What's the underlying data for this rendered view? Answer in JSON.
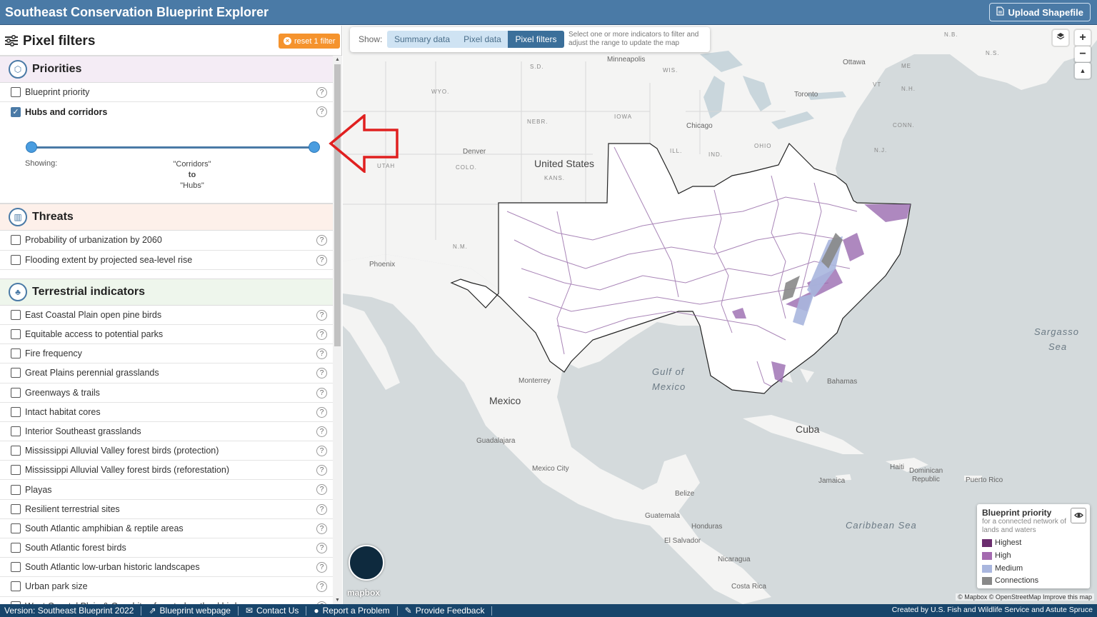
{
  "header": {
    "title": "Southeast  Conservation Blueprint Explorer",
    "upload_label": "Upload Shapefile"
  },
  "sidebar": {
    "title": "Pixel filters",
    "reset_label": "reset 1 filter",
    "priorities": {
      "title": "Priorities",
      "items": [
        {
          "label": "Blueprint priority",
          "checked": false
        },
        {
          "label": "Hubs and corridors",
          "checked": true
        }
      ],
      "slider": {
        "showing_label": "Showing:",
        "range_from": "\"Corridors\"",
        "range_to_word": "to",
        "range_to": "\"Hubs\""
      }
    },
    "threats": {
      "title": "Threats",
      "items": [
        {
          "label": "Probability of urbanization by 2060"
        },
        {
          "label": "Flooding extent by projected sea-level rise"
        }
      ]
    },
    "terrestrial": {
      "title": "Terrestrial indicators",
      "items": [
        {
          "label": "East Coastal Plain open pine birds"
        },
        {
          "label": "Equitable access to potential parks"
        },
        {
          "label": "Fire frequency"
        },
        {
          "label": "Great Plains perennial grasslands"
        },
        {
          "label": "Greenways & trails"
        },
        {
          "label": "Intact habitat cores"
        },
        {
          "label": "Interior Southeast grasslands"
        },
        {
          "label": "Mississippi Alluvial Valley forest birds (protection)"
        },
        {
          "label": "Mississippi Alluvial Valley forest birds (reforestation)"
        },
        {
          "label": "Playas"
        },
        {
          "label": "Resilient terrestrial sites"
        },
        {
          "label": "South Atlantic amphibian & reptile areas"
        },
        {
          "label": "South Atlantic forest birds"
        },
        {
          "label": "South Atlantic low-urban historic landscapes"
        },
        {
          "label": "Urban park size"
        },
        {
          "label": "West Coastal Plain & Ouachitas forested wetland birds"
        }
      ]
    },
    "help_glyph": "?"
  },
  "show_bar": {
    "label": "Show:",
    "options": [
      "Summary data",
      "Pixel data",
      "Pixel filters"
    ],
    "selected": "Pixel filters",
    "hint": "Select one or more indicators to filter and adjust the range to update the map"
  },
  "map_labels": {
    "us": "United States",
    "mexico": "Mexico",
    "cuba": "Cuba",
    "gulf": "Gulf of",
    "gulf2": "Mexico",
    "sargasso": "Sargasso",
    "sargasso2": "Sea",
    "caribbean": "Caribbean Sea",
    "minneapolis": "Minneapolis",
    "ottawa": "Ottawa",
    "toronto": "Toronto",
    "chicago": "Chicago",
    "denver": "Denver",
    "phoenix": "Phoenix",
    "monterrey": "Monterrey",
    "guadalajara": "Guadalajara",
    "mexico_city": "Mexico City",
    "bahamas": "Bahamas",
    "havana": "Haiti",
    "dominican": "Dominican",
    "dominican2": "Republic",
    "puerto_rico": "Puerto Rico",
    "jamaica": "Jamaica",
    "belize": "Belize",
    "guatemala": "Guatemala",
    "honduras": "Honduras",
    "el_salvador": "El Salvador",
    "nicaragua": "Nicaragua",
    "costa_rica": "Costa Rica",
    "sd": "S.D.",
    "wis": "WIS.",
    "nebr": "NEBR.",
    "iowa": "IOWA",
    "wyo": "WYO.",
    "utah": "UTAH",
    "colo": "COLO.",
    "kans": "KANS.",
    "nm": "N.M.",
    "ill": "ILL.",
    "ind": "IND.",
    "ohio": "OHIO",
    "nb": "N.B.",
    "me": "ME",
    "vt": "VT",
    "nh": "N.H.",
    "conn": "CONN.",
    "nj": "N.J.",
    "ns": "N.S."
  },
  "legend": {
    "title": "Blueprint priority",
    "subtitle": "for a connected network of lands and waters",
    "eye_icon": "eye-icon",
    "items": [
      {
        "label": "Highest",
        "color": "#6b2d6e"
      },
      {
        "label": "High",
        "color": "#a46ab0"
      },
      {
        "label": "Medium",
        "color": "#a9b6de"
      },
      {
        "label": "Connections",
        "color": "#888888"
      }
    ]
  },
  "map_controls": {
    "zoom_in": "+",
    "zoom_out": "−",
    "compass": "▲"
  },
  "mapbox_logo": "mapbox",
  "attribution": "© Mapbox © OpenStreetMap  Improve this map",
  "footer": {
    "version": "Version: Southeast Blueprint 2022",
    "webpage": "Blueprint webpage",
    "contact": "Contact Us",
    "report": "Report a Problem",
    "feedback": "Provide Feedback",
    "credit": "Created by U.S. Fish and Wildlife Service and Astute Spruce"
  },
  "colors": {
    "header": "#4a7aa6",
    "footer": "#18456b",
    "reset": "#f5932d",
    "accent": "#3b6f9a"
  }
}
